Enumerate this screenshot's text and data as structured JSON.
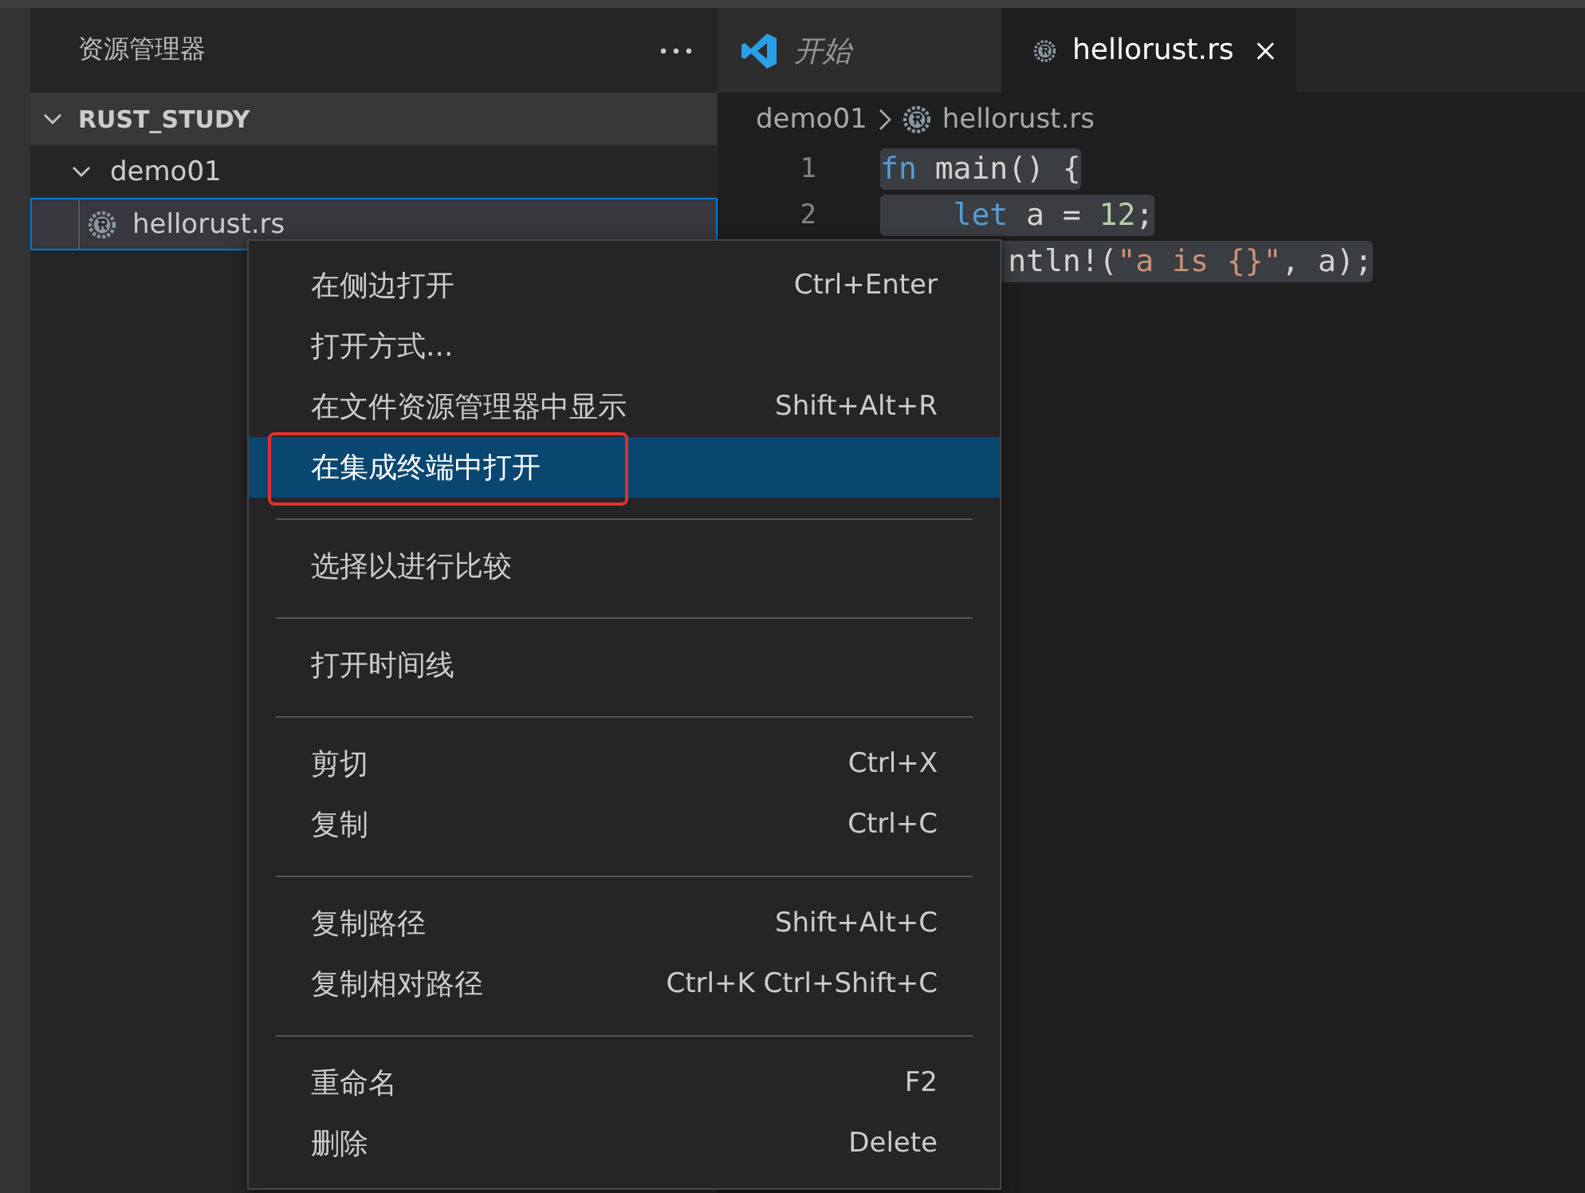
{
  "sidebar": {
    "title": "资源管理器",
    "tree": [
      {
        "label": "RUST_STUDY",
        "expanded": true,
        "children": [
          {
            "label": "demo01",
            "expanded": true,
            "children": [
              {
                "label": "hellorust.rs",
                "selected": true
              }
            ]
          }
        ]
      }
    ]
  },
  "tabs": [
    {
      "label": "开始",
      "kind": "welcome",
      "preview": true,
      "selected": false
    },
    {
      "label": "hellorust.rs",
      "kind": "rust",
      "preview": false,
      "selected": true
    }
  ],
  "breadcrumb": [
    "demo01",
    "hellorust.rs"
  ],
  "code_lines": [
    {
      "number": "1",
      "tokens": [
        {
          "kind": "keyword",
          "text": "fn"
        },
        {
          "kind": "plain",
          "text": " main() {"
        }
      ]
    },
    {
      "number": "2",
      "indented": true,
      "tokens": [
        {
          "kind": "keyword",
          "text": "let"
        },
        {
          "kind": "plain",
          "text": " a = "
        },
        {
          "kind": "number",
          "text": "12"
        },
        {
          "kind": "plain",
          "text": ";"
        }
      ]
    },
    {
      "tokens": [
        {
          "kind": "plain",
          "text": "       ntln!("
        },
        {
          "kind": "string",
          "text": "\"a is {}\""
        },
        {
          "kind": "plain",
          "text": ", a);"
        }
      ]
    }
  ],
  "context_menu": [
    [
      {
        "label": "在侧边打开",
        "shortcut": "Ctrl+Enter",
        "selected": false,
        "annotated": false
      },
      {
        "label": "打开方式...",
        "selected": false,
        "annotated": false
      },
      {
        "label": "在文件资源管理器中显示",
        "shortcut": "Shift+Alt+R",
        "selected": false,
        "annotated": false
      },
      {
        "label": "在集成终端中打开",
        "selected": true,
        "annotated": true
      }
    ],
    [
      {
        "label": "选择以进行比较",
        "selected": false,
        "annotated": false
      }
    ],
    [
      {
        "label": "打开时间线",
        "selected": false,
        "annotated": false
      }
    ],
    [
      {
        "label": "剪切",
        "shortcut": "Ctrl+X",
        "selected": false,
        "annotated": false
      },
      {
        "label": "复制",
        "shortcut": "Ctrl+C",
        "selected": false,
        "annotated": false
      }
    ],
    [
      {
        "label": "复制路径",
        "shortcut": "Shift+Alt+C",
        "selected": false,
        "annotated": false
      },
      {
        "label": "复制相对路径",
        "shortcut": "Ctrl+K Ctrl+Shift+C",
        "selected": false,
        "annotated": false
      }
    ],
    [
      {
        "label": "重命名",
        "shortcut": "F2",
        "selected": false,
        "annotated": false
      },
      {
        "label": "删除",
        "shortcut": "Delete",
        "selected": false,
        "annotated": false
      }
    ]
  ]
}
